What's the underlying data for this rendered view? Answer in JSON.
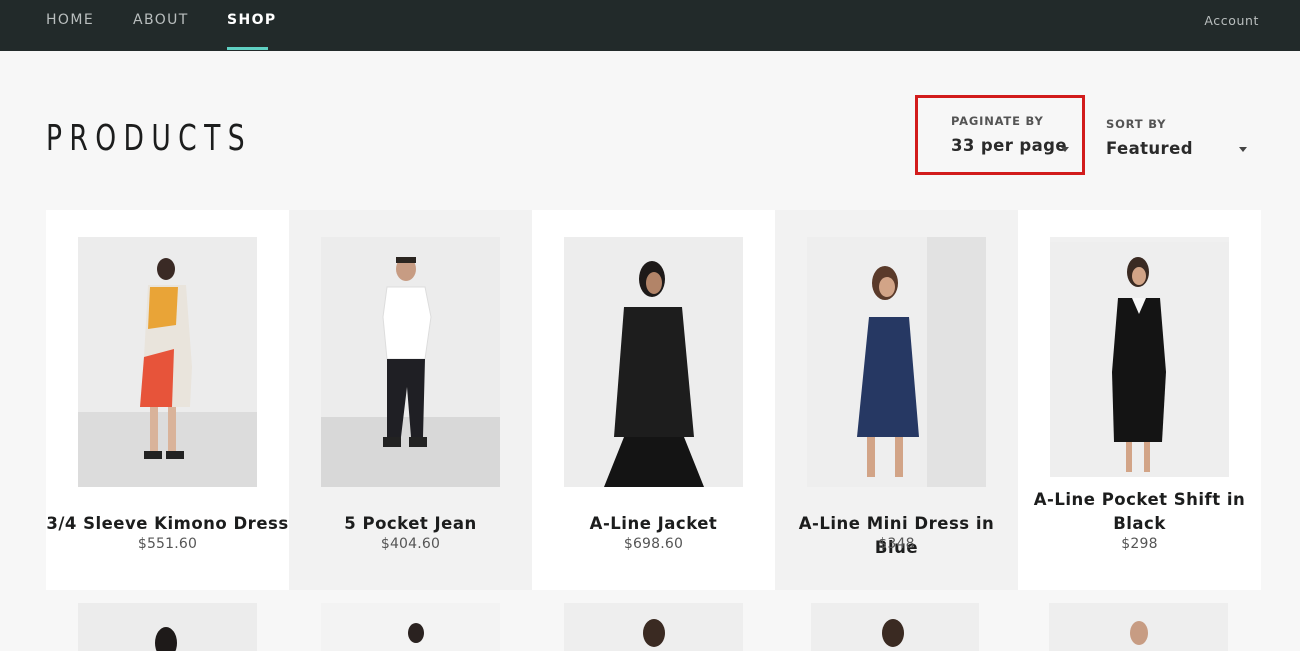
{
  "nav": {
    "items": [
      {
        "label": "HOME",
        "active": false
      },
      {
        "label": "ABOUT",
        "active": false
      },
      {
        "label": "SHOP",
        "active": true
      }
    ],
    "account": "Account"
  },
  "page": {
    "title": "PRODUCTS"
  },
  "filters": {
    "paginate": {
      "label": "PAGINATE BY",
      "value": "33 per page"
    },
    "sort": {
      "label": "SORT BY",
      "value": "Featured"
    }
  },
  "products": [
    {
      "name": "3/4 Sleeve Kimono Dress",
      "price": "$551.60",
      "image": "woman-kimono-dress-photo"
    },
    {
      "name": "5 Pocket Jean",
      "price": "$404.60",
      "image": "man-white-tee-jeans-photo"
    },
    {
      "name": "A-Line Jacket",
      "price": "$698.60",
      "image": "woman-black-jacket-photo"
    },
    {
      "name": "A-Line Mini Dress in Blue",
      "price": "$348",
      "image": "woman-blue-mini-dress-photo"
    },
    {
      "name": "A-Line Pocket Shift in Black",
      "price": "$298",
      "image": "woman-black-shift-photo"
    }
  ],
  "colors": {
    "nav_bg": "#222a2a",
    "nav_active_underline": "#5fd0c2",
    "highlight_border": "#d21c1c",
    "page_bg": "#f7f7f7"
  }
}
